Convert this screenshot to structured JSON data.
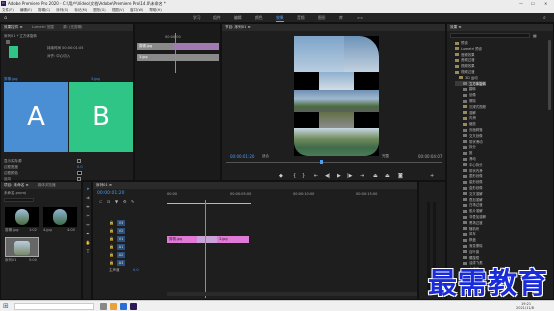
{
  "window": {
    "title": "Adobe Premiere Pro 2020 - C:\\用户\\Video\\文档\\Adobe\\Premiere Pro\\14.0\\未命名 *",
    "min": "—",
    "max": "☐",
    "close": "✕"
  },
  "menu": [
    "文件(F)",
    "编辑(E)",
    "剪辑(C)",
    "序列(S)",
    "标记(M)",
    "图形(G)",
    "视图(V)",
    "窗口(W)",
    "帮助(H)"
  ],
  "workspaces": [
    "学习",
    "组件",
    "编辑",
    "颜色",
    "效果",
    "音频",
    "图形",
    "库",
    ">>"
  ],
  "active_workspace": "效果",
  "effect_controls": {
    "tabs": [
      "效果控件 ≡",
      "Lumetri 范围",
      "源: (无剪辑)",
      "音频剪辑混合器: 序列"
    ],
    "clip_header": "序列01 * 立方体旋转",
    "line1": "持续时间 00:00:01:05",
    "line2": "对齐: 中心切入",
    "align_value": "中心切入",
    "label_a": "A",
    "label_b": "B",
    "tag_left": "剪辑.jpg",
    "tag_right": "3.jpg",
    "opt1": "显示实际源",
    "opt2": "边框宽度",
    "opt3": "边框颜色",
    "opt4": "反向",
    "opt5": "消除锯齿品质",
    "opt3_value": "关",
    "opt4_value": "0.0"
  },
  "mini_timeline": {
    "clip1": "剪辑.jpg",
    "clip2": "3.jpg",
    "timecode": "00:00:00"
  },
  "program": {
    "tab": "节目: 序列01 ≡",
    "timecode_left": "00:00:01:20",
    "fit": "适合",
    "quality": "完整",
    "timecode_right": "00:00:04:07"
  },
  "project": {
    "tabs": [
      "项目: 未命名 ≡",
      "媒体浏览器",
      "库"
    ],
    "file": "未命名.prproj",
    "items": [
      "剪辑.jpg",
      "4.jpg",
      "序列01"
    ],
    "item_meta": [
      "1:02",
      "4:00",
      "5:00"
    ]
  },
  "timeline": {
    "tab": "序列01 ≡",
    "timecode": "00:00:01:20",
    "tracks_v": [
      "V3",
      "V2",
      "V1"
    ],
    "tracks_a": [
      "A1",
      "A2",
      "A3"
    ],
    "master": "主声道",
    "master_value": "0.0",
    "clip1": "剪辑.jpg",
    "clip2": "3.jpg",
    "ruler": [
      "00:00",
      "00:00:05:00",
      "00:00:10:00",
      "00:00:15:00"
    ]
  },
  "effects": {
    "tab": "效果 ≡",
    "items": [
      "预设",
      "Lumetri 预设",
      "音频效果",
      "音频过渡",
      "视频效果",
      "视频过渡",
      "3D 运动",
      "立方体旋转",
      "翻转",
      "划像",
      "擦除",
      "沉浸式视频",
      "溶解",
      "内滑",
      "缩放",
      "页面剥落",
      "交叉划像",
      "带状滑动",
      "拆分",
      "推",
      "滑动",
      "中心拆分",
      "带状内滑",
      "菱形划像",
      "星形划像",
      "盒形划像",
      "交叉溶解",
      "叠加溶解",
      "白场过渡",
      "胶片溶解",
      "非叠加溶解",
      "黑场过渡",
      "随机块",
      "风车",
      "棋盘",
      "渐变擦除",
      "百叶窗",
      "螺旋框",
      "油漆飞溅",
      "水波块",
      "楔形擦除",
      "插入",
      "时钟式擦除",
      "双侧平推门"
    ]
  },
  "taskbar": {
    "time": "19:21",
    "date": "2021/11/8"
  },
  "watermark": "最需教育",
  "colors": {
    "accent": "#5ba4ff",
    "transition_a": "#4a8fd4",
    "transition_b": "#2fc587",
    "clip_pink": "#e07ad6",
    "timeline_yellow": "#e0c020"
  }
}
